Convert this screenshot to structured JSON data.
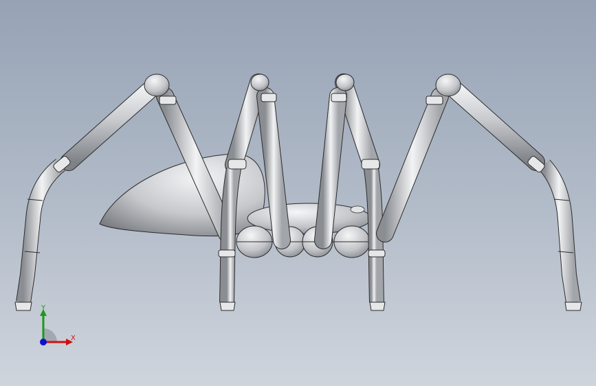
{
  "viewport": {
    "background_top": "#96a3b5",
    "background_bottom": "#cfd5dd"
  },
  "model": {
    "body_color": "#d4d6d9",
    "edge_color": "#2b2b2b"
  },
  "triad": {
    "y_label": "Y",
    "x_label": "X",
    "y_color": "#1a9a1a",
    "x_color": "#d01010",
    "z_color": "#1010d0"
  }
}
